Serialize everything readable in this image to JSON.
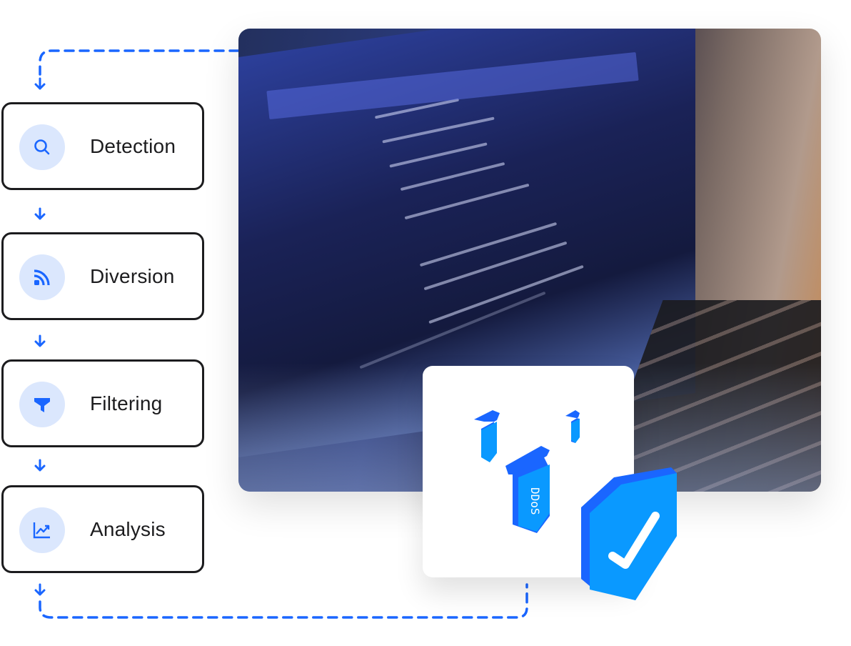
{
  "steps": [
    {
      "label": "Detection",
      "icon": "search-icon"
    },
    {
      "label": "Diversion",
      "icon": "rss-icon"
    },
    {
      "label": "Filtering",
      "icon": "filter-icon"
    },
    {
      "label": "Analysis",
      "icon": "chart-line-icon"
    }
  ],
  "illustration": {
    "bomb_label": "DDoS"
  },
  "colors": {
    "accent": "#1a66ff",
    "icon_bg": "#dbe7fd",
    "border": "#1c1c1e",
    "shield": "#0a99ff"
  }
}
